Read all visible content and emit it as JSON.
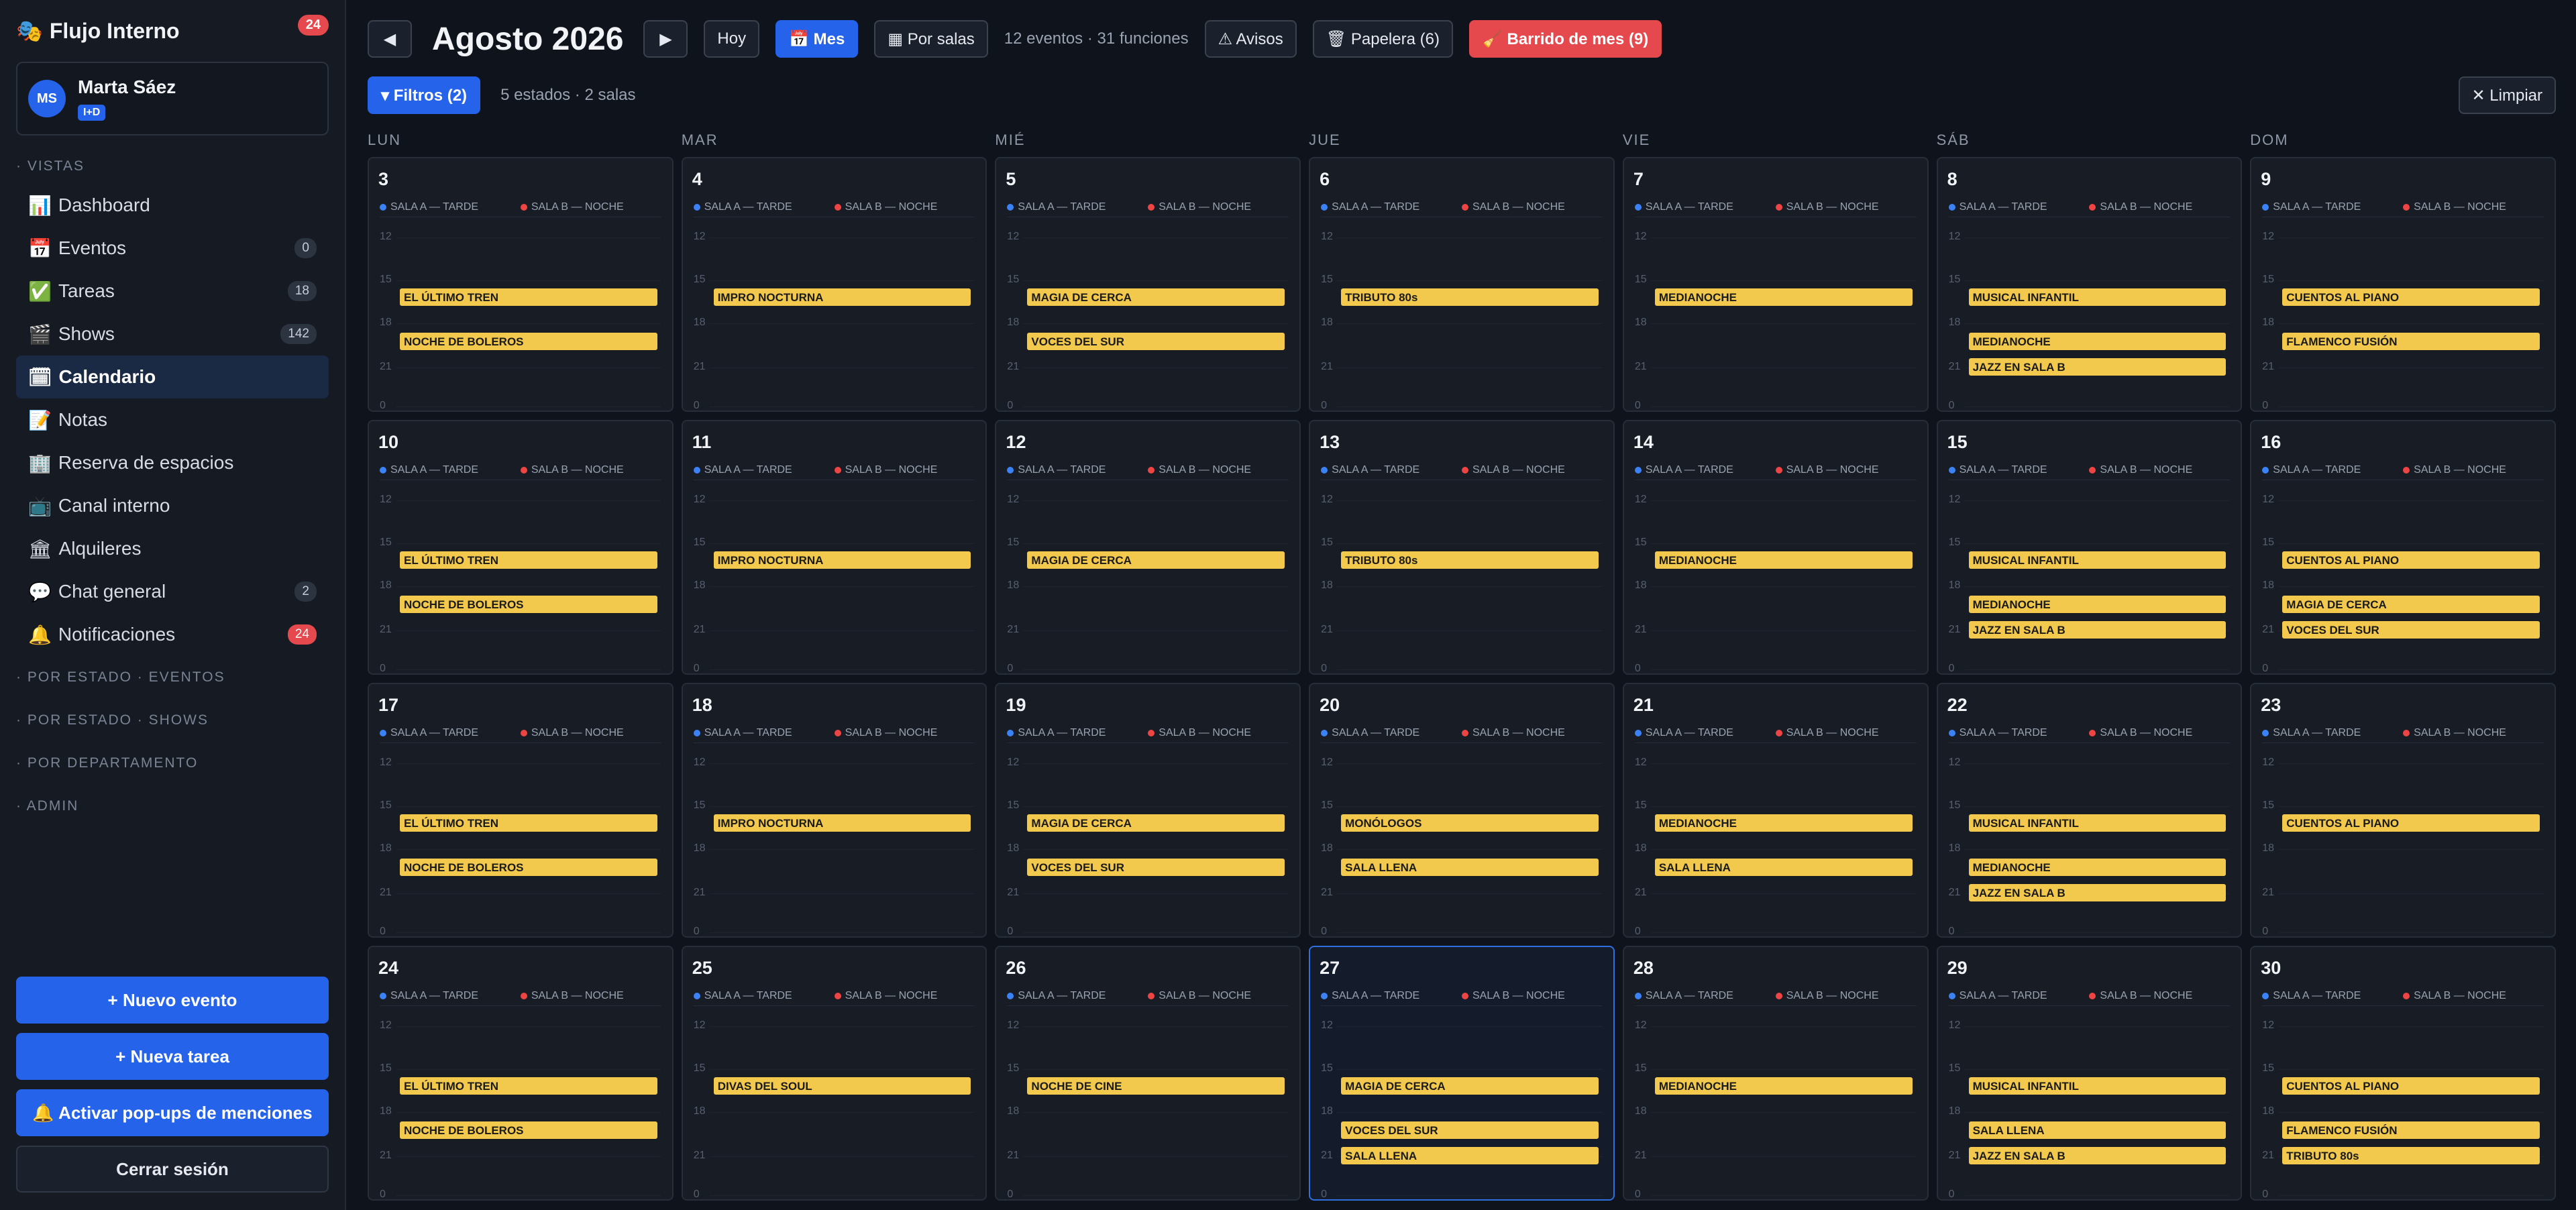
{
  "sidebar": {
    "brand_icon": "🎭",
    "brand": "Flujo Interno",
    "brand_badge": "24",
    "user": {
      "initials": "MS",
      "name": "Marta Sáez",
      "role": "I+D"
    },
    "section_views": "· VISTAS",
    "items": [
      {
        "icon": "📊",
        "label": "Dashboard",
        "count": ""
      },
      {
        "icon": "📅",
        "label": "Eventos",
        "count": "0"
      },
      {
        "icon": "✅",
        "label": "Tareas",
        "count": "18"
      },
      {
        "icon": "🎬",
        "label": "Shows",
        "count": "142"
      },
      {
        "icon": "🗓",
        "label": "Calendario",
        "count": ""
      },
      {
        "icon": "📝",
        "label": "Notas",
        "count": ""
      },
      {
        "icon": "🏢",
        "label": "Reserva de espacios",
        "count": ""
      },
      {
        "icon": "📺",
        "label": "Canal interno",
        "count": ""
      },
      {
        "icon": "🏛",
        "label": "Alquileres",
        "count": ""
      },
      {
        "icon": "💬",
        "label": "Chat general",
        "count": "2"
      },
      {
        "icon": "🔔",
        "label": "Notificaciones",
        "count": "24"
      }
    ],
    "groups": [
      "· POR ESTADO · EVENTOS",
      "· POR ESTADO · SHOWS",
      "· POR DEPARTAMENTO",
      "· ADMIN"
    ],
    "buttons": {
      "new_event": "+ Nuevo evento",
      "new_task": "+ Nueva tarea",
      "popups": "🔔 Activar pop-ups de menciones",
      "logout": "Cerrar sesión"
    }
  },
  "toolbar": {
    "prev": "◀",
    "title": "Agosto 2026",
    "next": "▶",
    "today": "Hoy",
    "month": "📅 Mes",
    "rooms_view": "▦ Por salas",
    "summary": "12 eventos · 31 funciones",
    "alerts": "⚠ Avisos",
    "trash": "🗑 Papelera (6)",
    "sweep": "🧹 Barrido de mes (9)"
  },
  "filters": {
    "button": "▾ Filtros (2)",
    "summary": "5 estados · 2 salas",
    "clear": "✕ Limpiar"
  },
  "calendar": {
    "weekdays": [
      "LUN",
      "MAR",
      "MIÉ",
      "JUE",
      "VIE",
      "SÁB",
      "DOM"
    ],
    "room_a": "SALA A — TARDE",
    "room_b": "SALA B — NOCHE",
    "ticks": [
      "12",
      "15",
      "18",
      "21",
      "0"
    ],
    "colors": {
      "room_a": "#3b82f6",
      "room_b": "#ef4444",
      "event": "#f2c94c",
      "today_border": "#2f6fe0"
    },
    "today": "27",
    "days": [
      {
        "day": "3",
        "events": [
          {
            "t": "EL ÚLTIMO TREN",
            "slot": 1
          },
          {
            "t": "NOCHE DE BOLEROS",
            "slot": 2
          }
        ]
      },
      {
        "day": "4",
        "events": [
          {
            "t": "IMPRO NOCTURNA",
            "slot": 1
          }
        ]
      },
      {
        "day": "5",
        "events": [
          {
            "t": "MAGIA DE CERCA",
            "slot": 1
          },
          {
            "t": "VOCES DEL SUR",
            "slot": 2
          }
        ]
      },
      {
        "day": "6",
        "events": [
          {
            "t": "TRIBUTO 80s",
            "slot": 1
          }
        ]
      },
      {
        "day": "7",
        "events": [
          {
            "t": "MEDIANOCHE",
            "slot": 1
          }
        ]
      },
      {
        "day": "8",
        "events": [
          {
            "t": "MUSICAL INFANTIL",
            "slot": 1
          },
          {
            "t": "MEDIANOCHE",
            "slot": 2
          },
          {
            "t": "JAZZ EN SALA B",
            "slot": 3
          }
        ]
      },
      {
        "day": "9",
        "events": [
          {
            "t": "CUENTOS AL PIANO",
            "slot": 1
          },
          {
            "t": "FLAMENCO FUSIÓN",
            "slot": 2
          }
        ]
      },
      {
        "day": "10",
        "events": [
          {
            "t": "EL ÚLTIMO TREN",
            "slot": 1
          },
          {
            "t": "NOCHE DE BOLEROS",
            "slot": 2
          }
        ]
      },
      {
        "day": "11",
        "events": [
          {
            "t": "IMPRO NOCTURNA",
            "slot": 1
          }
        ]
      },
      {
        "day": "12",
        "events": [
          {
            "t": "MAGIA DE CERCA",
            "slot": 1
          }
        ]
      },
      {
        "day": "13",
        "events": [
          {
            "t": "TRIBUTO 80s",
            "slot": 1
          }
        ]
      },
      {
        "day": "14",
        "events": [
          {
            "t": "MEDIANOCHE",
            "slot": 1
          }
        ]
      },
      {
        "day": "15",
        "events": [
          {
            "t": "MUSICAL INFANTIL",
            "slot": 1
          },
          {
            "t": "MEDIANOCHE",
            "slot": 2
          },
          {
            "t": "JAZZ EN SALA B",
            "slot": 3
          }
        ]
      },
      {
        "day": "16",
        "events": [
          {
            "t": "CUENTOS AL PIANO",
            "slot": 1
          },
          {
            "t": "MAGIA DE CERCA",
            "slot": 2
          },
          {
            "t": "VOCES DEL SUR",
            "slot": 3
          }
        ]
      },
      {
        "day": "17",
        "events": [
          {
            "t": "EL ÚLTIMO TREN",
            "slot": 1
          },
          {
            "t": "NOCHE DE BOLEROS",
            "slot": 2
          }
        ]
      },
      {
        "day": "18",
        "events": [
          {
            "t": "IMPRO NOCTURNA",
            "slot": 1
          }
        ]
      },
      {
        "day": "19",
        "events": [
          {
            "t": "MAGIA DE CERCA",
            "slot": 1
          },
          {
            "t": "VOCES DEL SUR",
            "slot": 2
          }
        ]
      },
      {
        "day": "20",
        "events": [
          {
            "t": "MONÓLOGOS",
            "slot": 1
          },
          {
            "t": "SALA LLENA",
            "slot": 2
          }
        ]
      },
      {
        "day": "21",
        "events": [
          {
            "t": "MEDIANOCHE",
            "slot": 1
          },
          {
            "t": "SALA LLENA",
            "slot": 2
          }
        ]
      },
      {
        "day": "22",
        "events": [
          {
            "t": "MUSICAL INFANTIL",
            "slot": 1
          },
          {
            "t": "MEDIANOCHE",
            "slot": 2
          },
          {
            "t": "JAZZ EN SALA B",
            "slot": 3
          }
        ]
      },
      {
        "day": "23",
        "events": [
          {
            "t": "CUENTOS AL PIANO",
            "slot": 1
          }
        ]
      },
      {
        "day": "24",
        "events": [
          {
            "t": "EL ÚLTIMO TREN",
            "slot": 1
          },
          {
            "t": "NOCHE DE BOLEROS",
            "slot": 2
          }
        ]
      },
      {
        "day": "25",
        "events": [
          {
            "t": "DIVAS DEL SOUL",
            "slot": 1
          }
        ]
      },
      {
        "day": "26",
        "events": [
          {
            "t": "NOCHE DE CINE",
            "slot": 1
          }
        ]
      },
      {
        "day": "27",
        "events": [
          {
            "t": "MAGIA DE CERCA",
            "slot": 1
          },
          {
            "t": "VOCES DEL SUR",
            "slot": 2
          },
          {
            "t": "SALA LLENA",
            "slot": 3
          }
        ]
      },
      {
        "day": "28",
        "events": [
          {
            "t": "MEDIANOCHE",
            "slot": 1
          }
        ]
      },
      {
        "day": "29",
        "events": [
          {
            "t": "MUSICAL INFANTIL",
            "slot": 1
          },
          {
            "t": "SALA LLENA",
            "slot": 2
          },
          {
            "t": "JAZZ EN SALA B",
            "slot": 3
          }
        ]
      },
      {
        "day": "30",
        "events": [
          {
            "t": "CUENTOS AL PIANO",
            "slot": 1
          },
          {
            "t": "FLAMENCO FUSIÓN",
            "slot": 2
          },
          {
            "t": "TRIBUTO 80s",
            "slot": 3
          }
        ]
      }
    ]
  }
}
